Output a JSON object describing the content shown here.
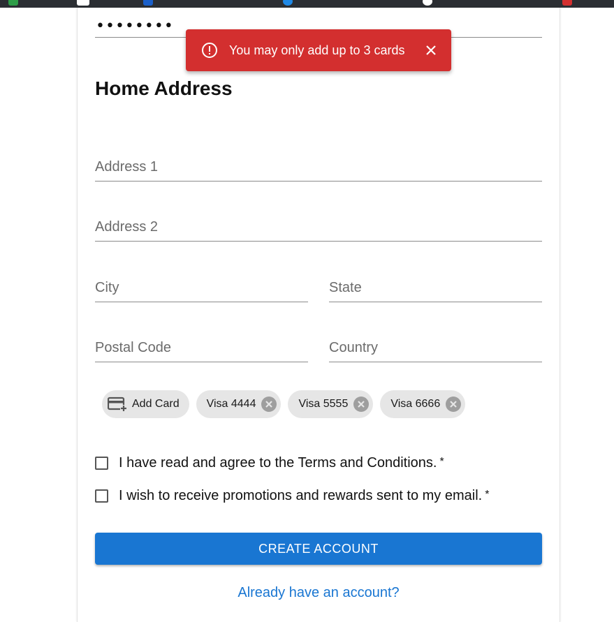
{
  "password": {
    "masked_value": "••••••••"
  },
  "home_address": {
    "title": "Home Address",
    "fields": {
      "address1": "Address 1",
      "address2": "Address 2",
      "city": "City",
      "state": "State",
      "postal_code": "Postal Code",
      "country": "Country"
    }
  },
  "cards": {
    "add_label": "Add Card",
    "items": [
      {
        "label": "Visa 4444"
      },
      {
        "label": "Visa 5555"
      },
      {
        "label": "Visa 6666"
      }
    ]
  },
  "agreements": {
    "terms": "I have read and agree to the Terms and Conditions.",
    "promotions": "I wish to receive promotions and rewards sent to my email.",
    "required_mark": "*"
  },
  "create_button_label": "CREATE ACCOUNT",
  "signin_link": "Already have an account?",
  "toast": {
    "message": "You may only add up to 3 cards",
    "color": "#d32f2f"
  },
  "colors": {
    "primary": "#1976d2",
    "error": "#d32f2f",
    "chip_bg": "#e6e6e6"
  }
}
